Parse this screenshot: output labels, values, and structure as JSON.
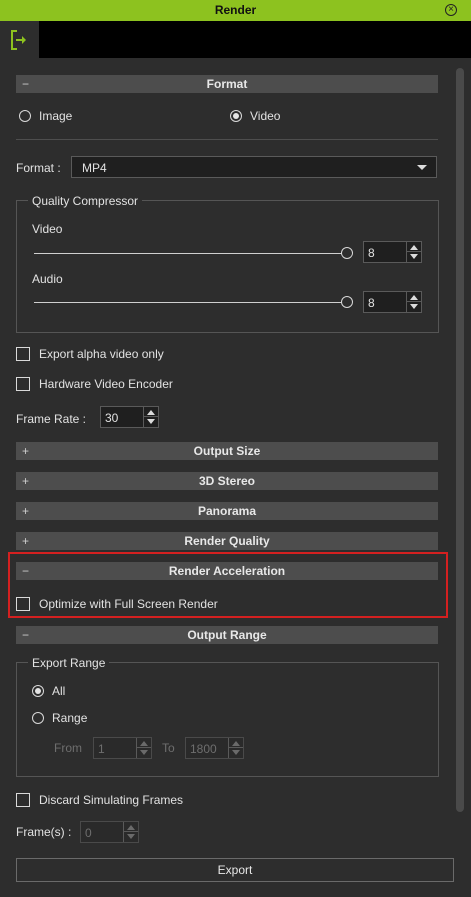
{
  "window": {
    "title": "Render"
  },
  "sections": {
    "format": "Format",
    "output_size": "Output Size",
    "stereo": "3D Stereo",
    "panorama": "Panorama",
    "render_quality": "Render Quality",
    "render_acceleration": "Render Acceleration",
    "output_range": "Output Range"
  },
  "signs": {
    "expanded": "−",
    "collapsed": "+"
  },
  "format_type": {
    "image_label": "Image",
    "video_label": "Video",
    "selected": "Video"
  },
  "format_select": {
    "label": "Format :",
    "value": "MP4"
  },
  "quality": {
    "title": "Quality Compressor",
    "video_label": "Video",
    "video_value": "8",
    "video_level": 1.0,
    "audio_label": "Audio",
    "audio_value": "8",
    "audio_level": 1.0
  },
  "export_alpha": {
    "label": "Export alpha video only",
    "checked": false
  },
  "hw_encoder": {
    "label": "Hardware Video Encoder",
    "checked": false
  },
  "frame_rate": {
    "label": "Frame Rate :",
    "value": "30"
  },
  "acceleration": {
    "label": "Optimize with Full Screen Render",
    "checked": false
  },
  "export_range": {
    "title": "Export Range",
    "all_label": "All",
    "range_label": "Range",
    "selected": "All",
    "from_label": "From",
    "from_value": "1",
    "to_label": "To",
    "to_value": "1800"
  },
  "discard": {
    "label": "Discard Simulating Frames",
    "checked": false
  },
  "frames": {
    "label": "Frame(s) :",
    "value": "0"
  },
  "export_button": "Export",
  "colors": {
    "title_bar": "#8dc21f",
    "panel_bg": "#2d2d2d",
    "highlight": "#d42020"
  },
  "icons": {
    "toolbar": "export-arrow-icon",
    "close": "close-circle-icon"
  }
}
